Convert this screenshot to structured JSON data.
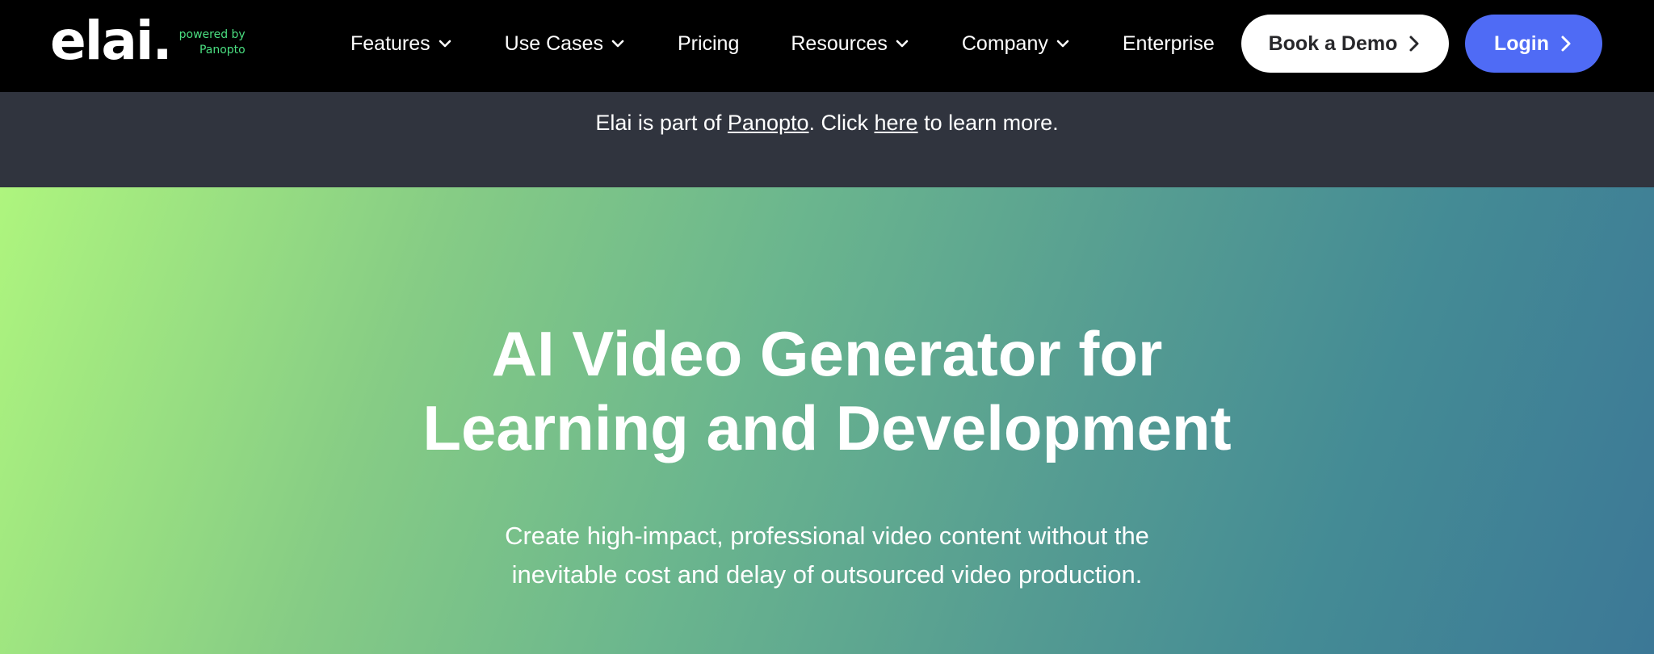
{
  "brand": {
    "logo_text": "elai.",
    "powered_by": "powered by",
    "parent": "Panopto",
    "accent_color": "#4ade80"
  },
  "nav": {
    "items": [
      {
        "label": "Features",
        "has_dropdown": true
      },
      {
        "label": "Use Cases",
        "has_dropdown": true
      },
      {
        "label": "Pricing",
        "has_dropdown": false
      },
      {
        "label": "Resources",
        "has_dropdown": true
      },
      {
        "label": "Company",
        "has_dropdown": true
      },
      {
        "label": "Enterprise",
        "has_dropdown": false
      }
    ],
    "demo_button": "Book a Demo",
    "login_button": "Login",
    "login_color": "#4f6bf5"
  },
  "announcement": {
    "prefix": "Elai is part of ",
    "link1": "Panopto",
    "middle": ". Click ",
    "link2": "here",
    "suffix": " to learn more."
  },
  "hero": {
    "title_line1": "AI Video Generator for",
    "title_line2": "Learning and Development",
    "subtitle": "Create high-impact, professional video content without the inevitable cost and delay of outsourced video production."
  }
}
